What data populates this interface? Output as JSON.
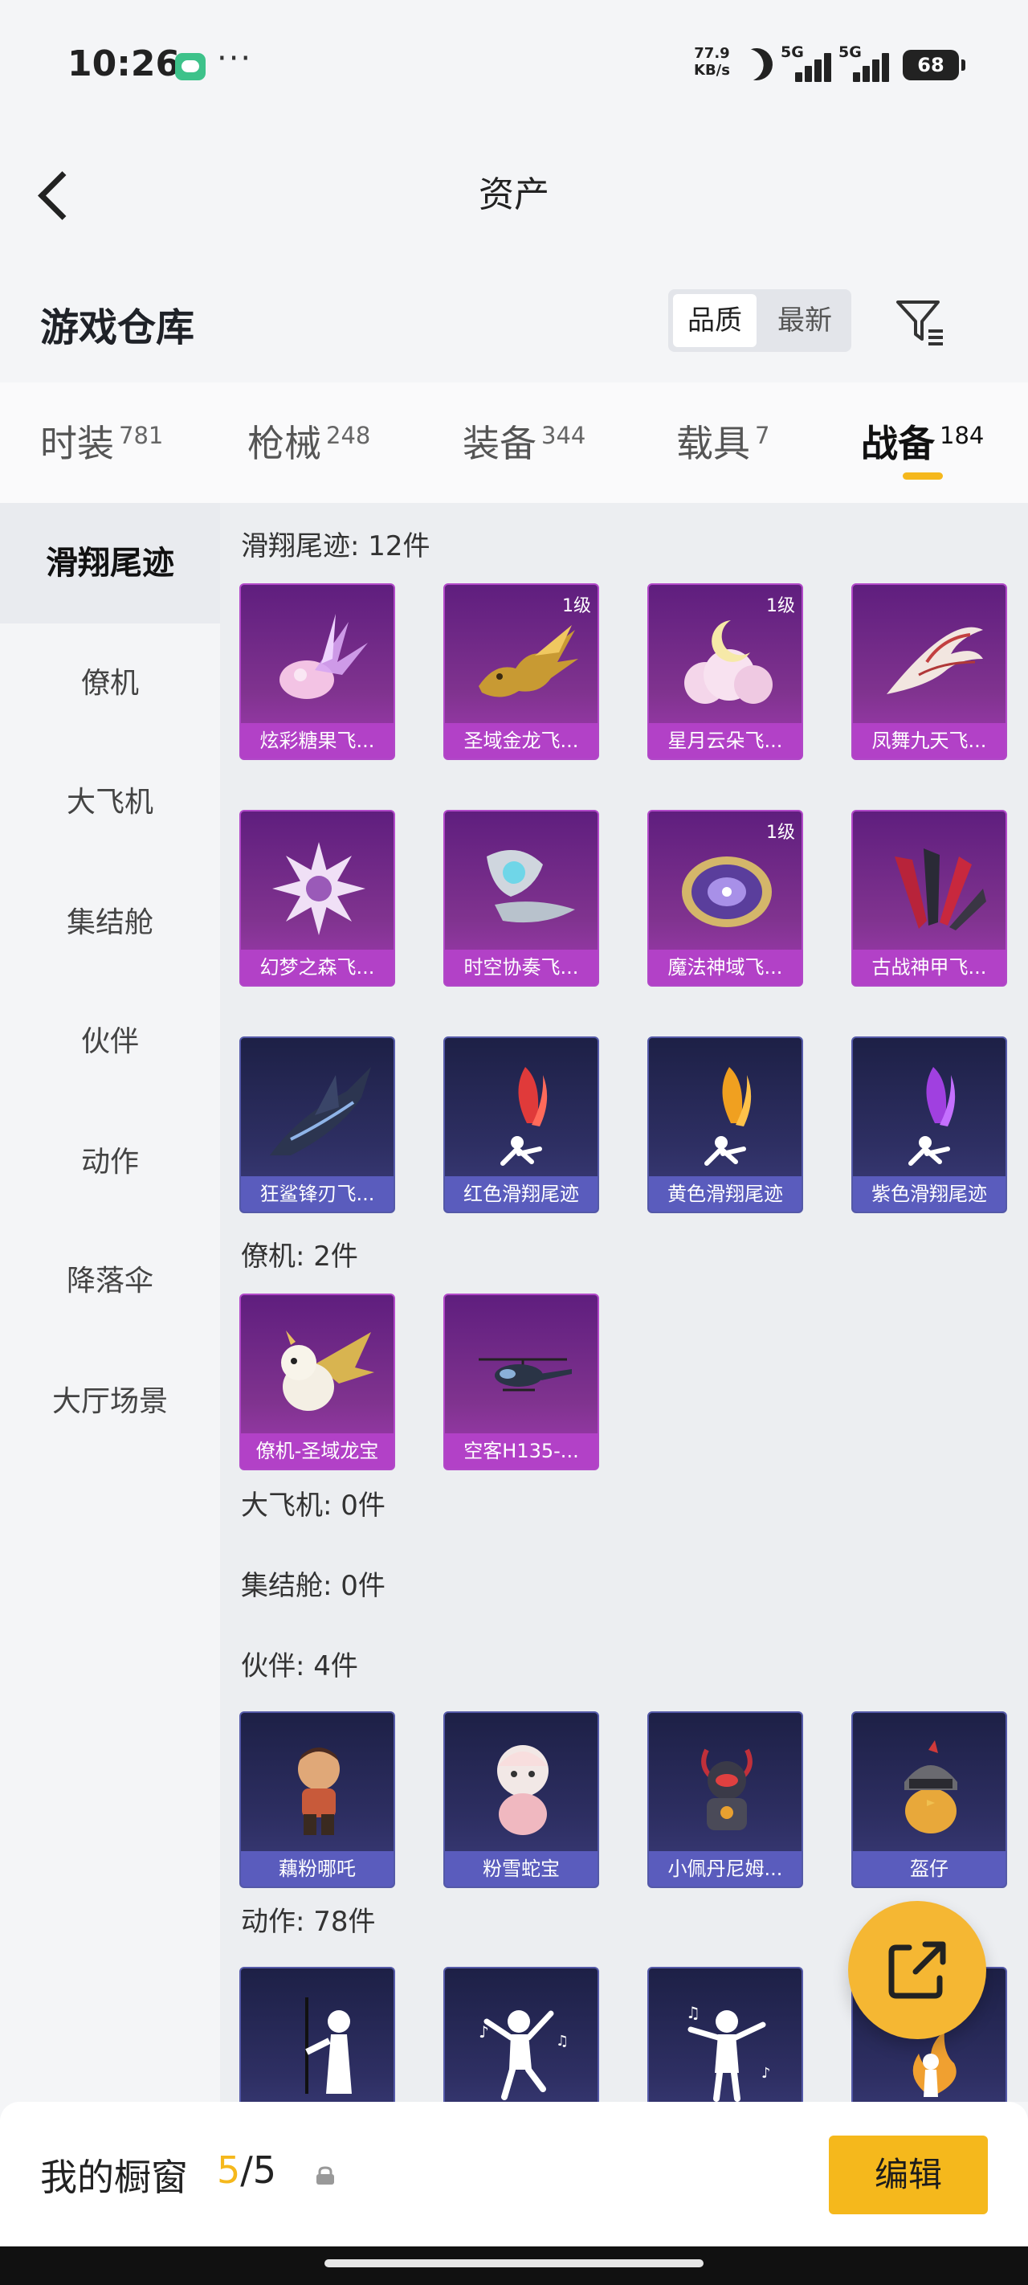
{
  "status_bar": {
    "time": "10:26",
    "more": "···",
    "net_speed_value": "77.9",
    "net_speed_unit": "KB/s",
    "signal1_label": "5G",
    "signal2_label": "5G",
    "battery": "68"
  },
  "header": {
    "title": "资产"
  },
  "warehouse": {
    "title": "游戏仓库",
    "sort_quality": "品质",
    "sort_newest": "最新"
  },
  "tabs": [
    {
      "label": "时装",
      "count": "781"
    },
    {
      "label": "枪械",
      "count": "248"
    },
    {
      "label": "装备",
      "count": "344"
    },
    {
      "label": "载具",
      "count": "7"
    },
    {
      "label": "战备",
      "count": "184"
    }
  ],
  "sidebar": [
    {
      "label": "滑翔尾迹"
    },
    {
      "label": "僚机"
    },
    {
      "label": "大飞机"
    },
    {
      "label": "集结舱"
    },
    {
      "label": "伙伴"
    },
    {
      "label": "动作"
    },
    {
      "label": "降落伞"
    },
    {
      "label": "大厅场景"
    }
  ],
  "sections": {
    "trails": {
      "title": "滑翔尾迹: 12件",
      "items": [
        {
          "name": "炫彩糖果飞...",
          "level": "",
          "icon": "candy-wing"
        },
        {
          "name": "圣域金龙飞...",
          "level": "1级",
          "icon": "golden-dragon"
        },
        {
          "name": "星月云朵飞...",
          "level": "1级",
          "icon": "moon-cloud"
        },
        {
          "name": "凤舞九天飞...",
          "level": "",
          "icon": "phoenix"
        },
        {
          "name": "幻梦之森飞...",
          "level": "",
          "icon": "dream-flower"
        },
        {
          "name": "时空协奏飞...",
          "level": "",
          "icon": "time-wing"
        },
        {
          "name": "魔法神域飞...",
          "level": "1级",
          "icon": "magic-disk"
        },
        {
          "name": "古战神甲飞...",
          "level": "",
          "icon": "ancient-armor-wing"
        },
        {
          "name": "狂鲨锋刃飞...",
          "level": "",
          "icon": "shark-blade"
        },
        {
          "name": "红色滑翔尾迹",
          "level": "",
          "icon": "red-smoke"
        },
        {
          "name": "黄色滑翔尾迹",
          "level": "",
          "icon": "yellow-smoke"
        },
        {
          "name": "紫色滑翔尾迹",
          "level": "",
          "icon": "purple-smoke"
        }
      ]
    },
    "wingman": {
      "title": "僚机: 2件",
      "items": [
        {
          "name": "僚机-圣域龙宝",
          "icon": "dragon-pet"
        },
        {
          "name": "空客H135-...",
          "icon": "helicopter"
        }
      ]
    },
    "big_plane": {
      "title": "大飞机: 0件"
    },
    "capsule": {
      "title": "集结舱: 0件"
    },
    "partner": {
      "title": "伙伴: 4件",
      "items": [
        {
          "name": "藕粉哪吒",
          "icon": "nezha"
        },
        {
          "name": "粉雪蛇宝",
          "icon": "snow-snake"
        },
        {
          "name": "小佩丹尼姆...",
          "icon": "armored-pet"
        },
        {
          "name": "盔仔",
          "icon": "helmet-chick"
        }
      ]
    },
    "action": {
      "title": "动作: 78件",
      "items": [
        {
          "name": "",
          "icon": "emote-sword"
        },
        {
          "name": "",
          "icon": "emote-dance"
        },
        {
          "name": "",
          "icon": "emote-music"
        },
        {
          "name": "",
          "icon": "emote-fire"
        }
      ]
    }
  },
  "bottom": {
    "showcase_label": "我的橱窗",
    "showcase_current": "5",
    "showcase_total": "/5",
    "edit_label": "编辑"
  },
  "colors": {
    "accent": "#f5b81c",
    "purple_card": "#80338f",
    "navy_card": "#2e2f63"
  }
}
